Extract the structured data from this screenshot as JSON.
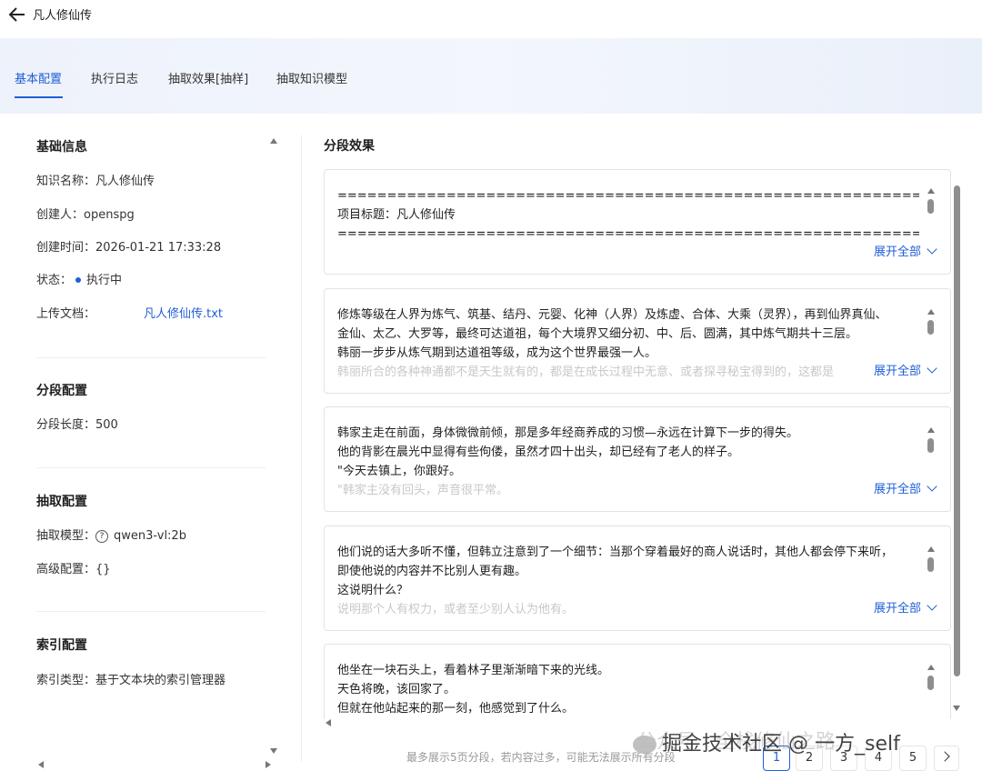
{
  "header": {
    "title": "凡人修仙传"
  },
  "tabs": [
    {
      "label": "基本配置",
      "active": true
    },
    {
      "label": "执行日志"
    },
    {
      "label": "抽取效果[抽样]"
    },
    {
      "label": "抽取知识模型"
    }
  ],
  "basic_info": {
    "title": "基础信息",
    "name_label": "知识名称：",
    "name_value": "凡人修仙传",
    "creator_label": "创建人：",
    "creator_value": "openspg",
    "created_label": "创建时间：",
    "created_value": "2026-01-21 17:33:28",
    "status_label": "状态：",
    "status_value": "执行中",
    "upload_label": "上传文档：",
    "upload_value": "凡人修仙传.txt"
  },
  "segment_config": {
    "title": "分段配置",
    "length_label": "分段长度：",
    "length_value": "500"
  },
  "extract_config": {
    "title": "抽取配置",
    "model_label": "抽取模型：",
    "model_value": "qwen3-vl:2b",
    "advanced_label": "高级配置：",
    "advanced_value": "{}"
  },
  "index_config": {
    "title": "索引配置",
    "type_label": "索引类型：",
    "type_value": "基于文本块的索引管理器"
  },
  "segments": {
    "title": "分段效果",
    "expand_label": "展开全部",
    "cards": [
      {
        "lines": [
          "================================================================",
          "项目标题：凡人修仙传",
          "================================================================"
        ],
        "faded": ""
      },
      {
        "lines": [
          "修炼等级在人界为炼气、筑基、结丹、元婴、化神（人界）及炼虚、合体、大乘（灵界），再到仙界真仙、",
          "金仙、太乙、大罗等，最终可达道祖，每个大境界又细分初、中、后、圆满，其中炼气期共十三层。",
          "韩丽一步步从炼气期到达道祖等级，成为这个世界最强一人。"
        ],
        "faded": "韩丽所合的各种神通都不是天生就有的，都是在成长过程中无意、或者探寻秘宝得到的，这都是"
      },
      {
        "lines": [
          "韩家主走在前面，身体微微前倾，那是多年经商养成的习惯—永远在计算下一步的得失。",
          "他的背影在晨光中显得有些佝偻，虽然才四十出头，却已经有了老人的样子。",
          "\"今天去镇上，你跟好。"
        ],
        "faded": "\"韩家主没有回头，声音很平常。"
      },
      {
        "lines": [
          "他们说的话大多听不懂，但韩立注意到了一个细节：当那个穿着最好的商人说话时，其他人都会停下来听，",
          "即使他说的内容并不比别人更有趣。",
          "这说明什么？"
        ],
        "faded": "说明那个人有权力，或者至少别人认为他有。"
      },
      {
        "lines": [
          "他坐在一块石头上，看着林子里渐渐暗下来的光线。",
          "天色将晚，该回家了。",
          "但就在他站起来的那一刻，他感觉到了什么。"
        ],
        "faded": ""
      }
    ]
  },
  "footer": {
    "note": "最多展示5页分段，若内容过多，可能无法展示所有分段",
    "pages": [
      "1",
      "2",
      "3",
      "4",
      "5"
    ],
    "current_page": "1"
  },
  "watermark": "掘金技术社区 @ 一方_self",
  "watermark_back": "公众号 · 全栈修仙之路"
}
